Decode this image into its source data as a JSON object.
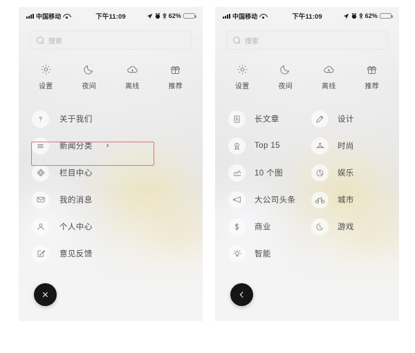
{
  "status_bar": {
    "carrier": "中国移动",
    "time": "下午11:09",
    "battery_percent": "62%",
    "battery_level": 62,
    "icons": [
      "signal-icon",
      "wifi-icon",
      "location-arrow-icon",
      "alarm-icon",
      "bluetooth-icon",
      "battery-icon"
    ]
  },
  "search": {
    "placeholder": "搜索",
    "value": "",
    "icon": "search-icon"
  },
  "quick_actions": [
    {
      "label": "设置",
      "icon": "gear-icon"
    },
    {
      "label": "夜间",
      "icon": "moon-icon"
    },
    {
      "label": "离线",
      "icon": "cloud-download-icon"
    },
    {
      "label": "推荐",
      "icon": "gift-icon"
    }
  ],
  "left_panel": {
    "menu": [
      {
        "label": "关于我们",
        "icon": "question-mark-icon",
        "chevron": "",
        "highlighted": false
      },
      {
        "label": "新闻分类",
        "icon": "hamburger-lines-icon",
        "chevron": "›",
        "highlighted": true
      },
      {
        "label": "栏目中心",
        "icon": "diamond-icon",
        "chevron": "",
        "highlighted": false
      },
      {
        "label": "我的消息",
        "icon": "envelope-icon",
        "chevron": "",
        "highlighted": false
      },
      {
        "label": "个人中心",
        "icon": "person-icon",
        "chevron": "",
        "highlighted": false
      },
      {
        "label": "意见反馈",
        "icon": "feedback-edit-icon",
        "chevron": "",
        "highlighted": false
      }
    ],
    "fab": {
      "icon": "close-x-icon",
      "label": "×"
    }
  },
  "right_panel": {
    "categories": [
      {
        "label": "长文章",
        "icon": "document-icon"
      },
      {
        "label": "设计",
        "icon": "pencil-icon"
      },
      {
        "label": "Top 15",
        "icon": "medal-icon"
      },
      {
        "label": "时尚",
        "icon": "hanger-icon"
      },
      {
        "label": "10 个图",
        "icon": "chart-line-icon"
      },
      {
        "label": "娱乐",
        "icon": "pie-chart-icon"
      },
      {
        "label": "大公司头条",
        "icon": "megaphone-icon"
      },
      {
        "label": "城市",
        "icon": "bicycle-icon"
      },
      {
        "label": "商业",
        "icon": "dollar-icon"
      },
      {
        "label": "游戏",
        "icon": "moon-clock-icon"
      },
      {
        "label": "智能",
        "icon": "lightbulb-icon"
      }
    ],
    "fab": {
      "icon": "chevron-left-icon",
      "label": "‹"
    }
  },
  "colors": {
    "highlight_border": "#e0707a",
    "fab_background": "#151515",
    "battery_fill": "#f8b301",
    "text_primary": "#4a4a4c"
  }
}
